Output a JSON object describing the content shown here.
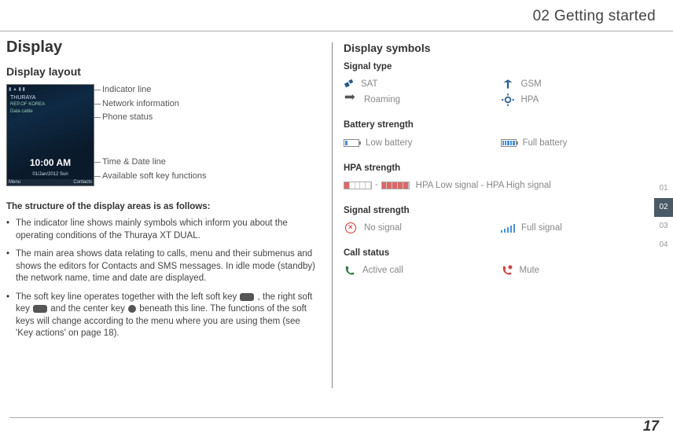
{
  "header": "02 Getting started",
  "title": "Display",
  "layout": {
    "heading": "Display layout",
    "callouts": {
      "indicator": "Indicator line",
      "network": "Network information",
      "status": "Phone status",
      "timedate": "Time & Date line",
      "softkey": "Available soft key functions"
    },
    "phone": {
      "brand": "THURAYA",
      "country": "REP.OF KOREA",
      "mode": "Data cable",
      "time": "10:00 AM",
      "date": "01/Jan/2012 Sun",
      "menu": "Menu",
      "contacts": "Contacts"
    },
    "structureHeading": "The structure of the display areas is as follows:",
    "bullets": [
      "The indicator line shows mainly symbols which inform you about the operating conditions of the Thuraya XT DUAL.",
      "The main area shows data relating to calls, menu and their submenus and shows the editors for Contacts and SMS messages. In idle mode (standby) the network name, time and date are displayed.",
      "The soft key line operates together with the left soft key ⬚ , the right soft key ⬚ and the center key ● beneath this line. The functions of the soft keys will change according to the menu where you are using them (see 'Key actions' on page 18)."
    ]
  },
  "symbols": {
    "heading": "Display symbols",
    "signalType": {
      "h": "Signal type",
      "sat": "SAT",
      "gsm": "GSM",
      "roaming": "Roaming",
      "hpa": "HPA"
    },
    "battery": {
      "h": "Battery strength",
      "low": "Low battery",
      "full": "Full battery"
    },
    "hpast": {
      "h": "HPA strength",
      "desc": "HPA Low signal - HPA High signal",
      "sep": "-"
    },
    "sigst": {
      "h": "Signal strength",
      "no": "No signal",
      "full": "Full signal"
    },
    "call": {
      "h": "Call status",
      "active": "Active call",
      "mute": "Mute"
    }
  },
  "tabs": [
    "01",
    "02",
    "03",
    "04"
  ],
  "activeTab": 1,
  "pageNum": "17"
}
